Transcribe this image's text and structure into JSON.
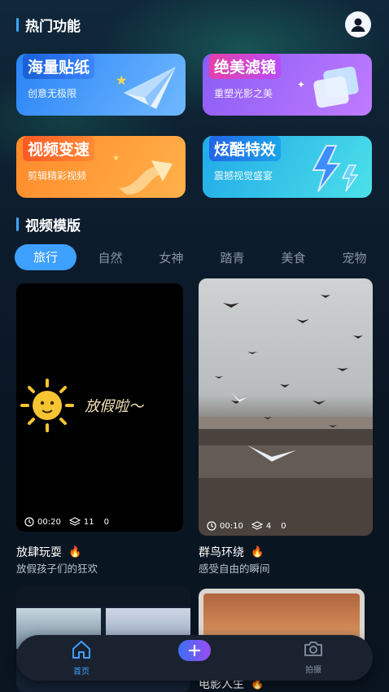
{
  "hot": {
    "title": "热门功能"
  },
  "cards": [
    {
      "title": "海量贴纸",
      "sub": "创意无极限"
    },
    {
      "title": "绝美滤镜",
      "sub": "重塑光影之美"
    },
    {
      "title": "视频变速",
      "sub": "剪辑精彩视频"
    },
    {
      "title": "炫酷特效",
      "sub": "震撼视觉盛宴"
    }
  ],
  "templates": {
    "title": "视频模版"
  },
  "tabs": [
    "旅行",
    "自然",
    "女神",
    "踏青",
    "美食",
    "宠物"
  ],
  "videos": [
    {
      "overlay_text": "放假啦～",
      "duration": "00:20",
      "layers": "11",
      "count": "0",
      "name": "放肆玩耍",
      "desc": "放假孩子们的狂欢"
    },
    {
      "duration": "00:10",
      "layers": "4",
      "count": "0",
      "name": "群鸟环绕",
      "desc": "感受自由的瞬间"
    },
    {
      "name": "电影人生"
    }
  ],
  "nav": {
    "home": "首页",
    "camera": "拍摄"
  },
  "colors": {
    "accent": "#3ea0ff",
    "background": "#0b1626"
  }
}
